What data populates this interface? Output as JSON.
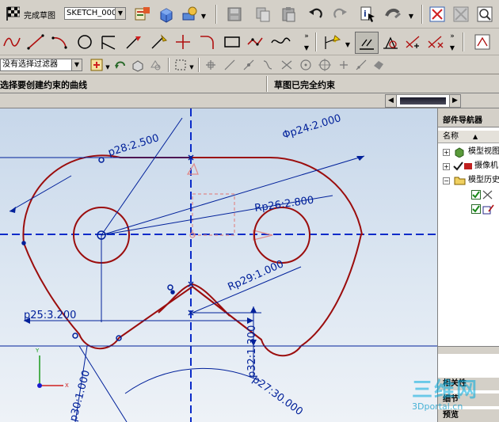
{
  "toolbar": {
    "finish_sketch_label": "完成草图",
    "sketch_name": "SKETCH_000"
  },
  "selection": {
    "filter_label": "没有选择过滤器"
  },
  "cue_line": {
    "prompt": "选择要创建约束的曲线",
    "status": "草图已完全约束"
  },
  "part_navigator": {
    "title": "部件导航器",
    "column_name": "名称",
    "items": [
      {
        "label": "模型视图"
      },
      {
        "label": "摄像机"
      },
      {
        "label": "模型历史记录"
      }
    ],
    "section_related": "相关性",
    "section_details": "细节",
    "section_preview": "预览"
  },
  "dimensions": {
    "d_outer_left": "p28:2.500",
    "d_dia": "Φp24:2.000",
    "d_right": "Rp26:2.800",
    "d_inner": "Rp29:1.000",
    "d_horiz": "p25:3.200",
    "d_vert": "p32:1.300",
    "d_angle": "p27:30.000",
    "d_bottom": "p30:1.000"
  },
  "watermark": {
    "brand": "三维网",
    "url": "3Dportal.cn"
  },
  "colors": {
    "sketch_curve": "#9b0d0d",
    "centerline": "#0a2bc9",
    "dimension": "#00209a"
  }
}
